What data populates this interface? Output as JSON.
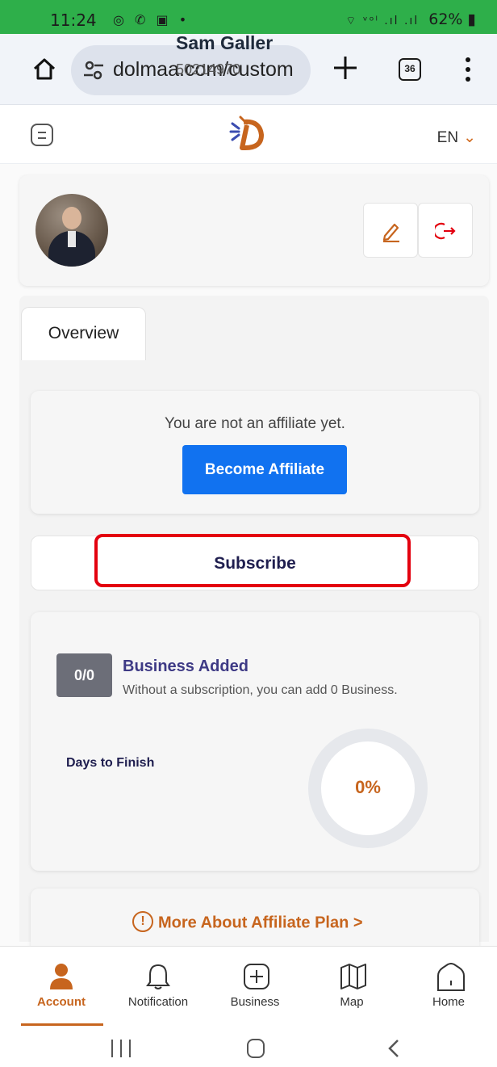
{
  "status_bar": {
    "time": "11:24",
    "notification_icons": "◎ ✆ ▣ •",
    "signal_icons": "⌔ ᵛᵒˡ .ıl .ıl",
    "battery": "62%"
  },
  "browser": {
    "url": "dolmaa.com/custom",
    "tabs_count": "36"
  },
  "header": {
    "language": "EN"
  },
  "profile": {
    "name": "Sam Galler",
    "user_id": "50214970"
  },
  "tabs": {
    "overview": "Overview"
  },
  "affiliate": {
    "message": "You are not an affiliate yet.",
    "button": "Become Affiliate"
  },
  "subscribe": {
    "label": "Subscribe"
  },
  "business": {
    "count": "0/0",
    "title": "Business Added",
    "description": "Without a subscription, you can add 0 Business.",
    "days_label": "Days to Finish",
    "progress": "0%",
    "progress_fraction": 0
  },
  "more_affiliate": {
    "label": "More About Affiliate Plan",
    "chevron": ">",
    "info_glyph": "!"
  },
  "bottom_nav": {
    "account": "Account",
    "notification": "Notification",
    "business": "Business",
    "map": "Map",
    "home": "Home"
  },
  "colors": {
    "accent": "#c7651e",
    "primary_blue": "#1172f0",
    "navy": "#1f1e4f",
    "status_green": "#2eaf4a",
    "highlight_red": "#e3000f"
  },
  "icons": {
    "browser_home": "home-icon",
    "site_settings": "tune-icon",
    "new_tab": "plus-icon",
    "menu": "menu-icon",
    "edit": "pencil-icon",
    "logout": "logout-icon",
    "info": "info-icon",
    "account": "person-icon",
    "notification": "bell-icon",
    "business": "plus-square-icon",
    "map": "map-icon",
    "home": "house-icon"
  }
}
